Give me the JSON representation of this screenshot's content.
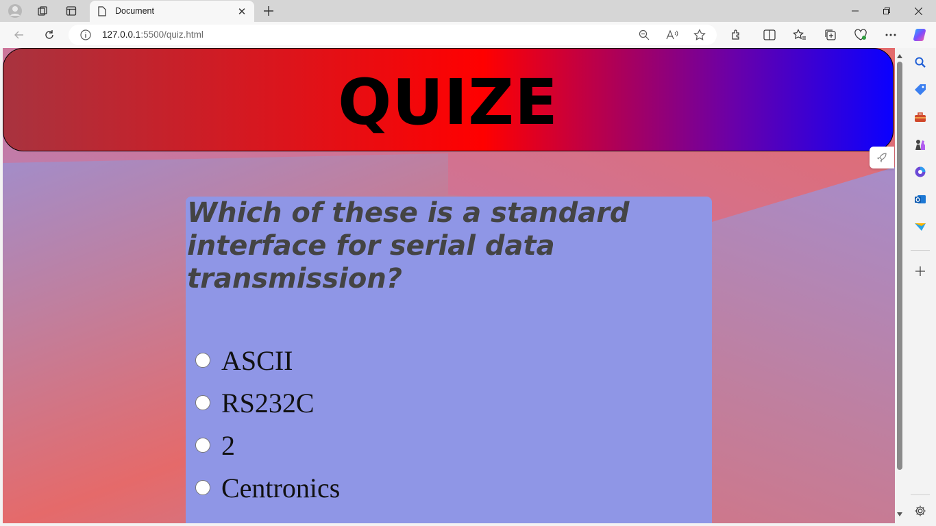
{
  "browser": {
    "tab_title": "Document",
    "address_host": "127.0.0.1",
    "address_rest": ":5500/quiz.html"
  },
  "page": {
    "header_title": "QUIZE",
    "question": "Which of these is a standard interface for serial data transmission?",
    "options": [
      {
        "label": "ASCII",
        "selected": false
      },
      {
        "label": "RS232C",
        "selected": false
      },
      {
        "label": "2",
        "selected": false
      },
      {
        "label": "Centronics",
        "selected": false
      }
    ]
  },
  "colors": {
    "header_gradient": [
      "#a8333f",
      "#ff0000",
      "#0a00ff"
    ],
    "card_bg": "#8f96e6",
    "question_text": "#444444"
  },
  "icons": {
    "sidebar": [
      "search-icon",
      "tag-icon",
      "toolbox-icon",
      "chess-icon",
      "office-icon",
      "outlook-icon",
      "send-icon",
      "add-icon",
      "settings-icon"
    ]
  }
}
